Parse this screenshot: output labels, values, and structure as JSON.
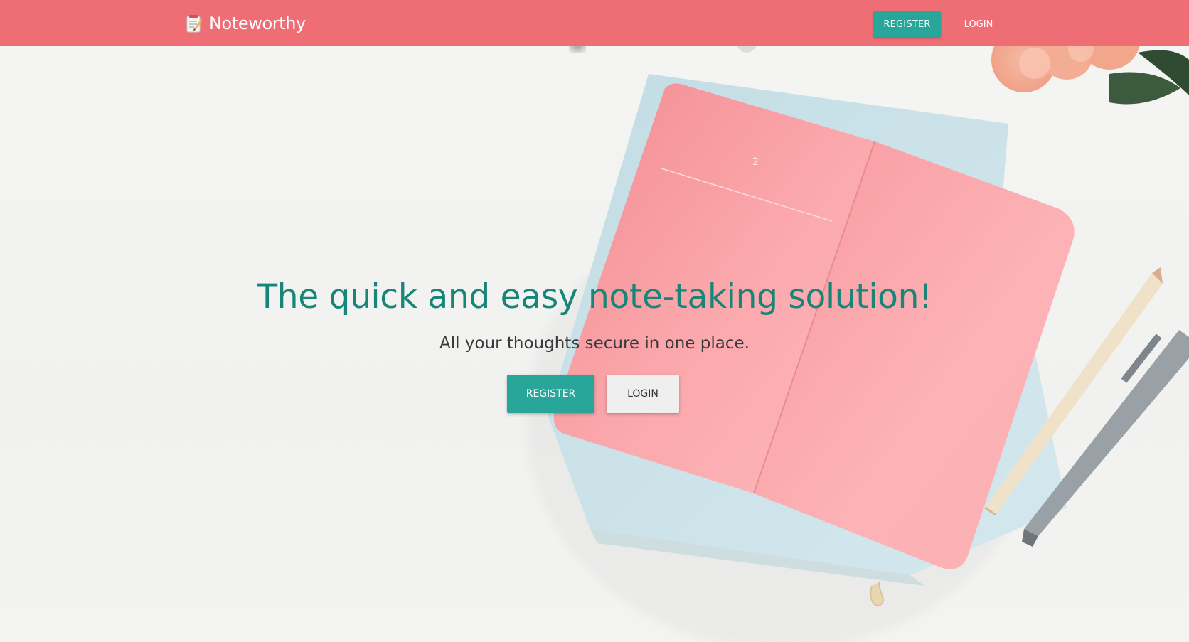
{
  "navbar": {
    "brand_name": "Noteworthy",
    "brand_icon": "memo-icon",
    "register_label": "REGISTER",
    "login_label": "LOGIN"
  },
  "hero": {
    "headline": "The quick and easy note-taking solution!",
    "subheadline": "All your thoughts secure in one place.",
    "register_label": "REGISTER",
    "login_label": "LOGIN",
    "notebook_page_number": "2"
  },
  "colors": {
    "navbar_background": "#ef6e75",
    "primary_button": "#27a699",
    "secondary_button": "#efefef",
    "headline_text": "#178578"
  }
}
